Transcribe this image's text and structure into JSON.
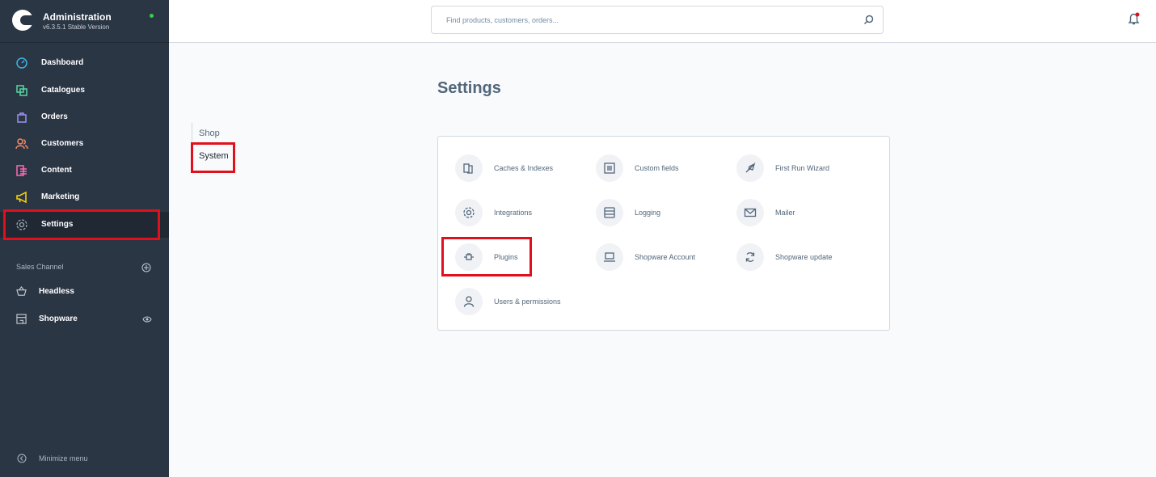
{
  "brand": {
    "title": "Administration",
    "version": "v6.3.5.1 Stable Version"
  },
  "nav": [
    {
      "label": "Dashboard",
      "icon": "dashboard-icon",
      "color": "#3db2e4"
    },
    {
      "label": "Catalogues",
      "icon": "catalogues-icon",
      "color": "#57d9a3"
    },
    {
      "label": "Orders",
      "icon": "orders-icon",
      "color": "#a092f0"
    },
    {
      "label": "Customers",
      "icon": "customers-icon",
      "color": "#f88962"
    },
    {
      "label": "Content",
      "icon": "content-icon",
      "color": "#ff68b4"
    },
    {
      "label": "Marketing",
      "icon": "marketing-icon",
      "color": "#ffd700"
    },
    {
      "label": "Settings",
      "icon": "settings-gear-icon",
      "color": "#9aa8b5"
    }
  ],
  "sales_channel": {
    "title": "Sales Channel",
    "items": [
      {
        "label": "Headless",
        "icon": "basket-icon"
      },
      {
        "label": "Shopware",
        "icon": "storefront-icon"
      }
    ]
  },
  "minimize_label": "Minimize menu",
  "search": {
    "placeholder": "Find products, customers, orders..."
  },
  "page": {
    "title": "Settings"
  },
  "tabs": [
    "Shop",
    "System"
  ],
  "settings": [
    {
      "label": "Caches & Indexes",
      "icon": "caches-icon"
    },
    {
      "label": "Custom fields",
      "icon": "custom-fields-icon"
    },
    {
      "label": "First Run Wizard",
      "icon": "rocket-icon"
    },
    {
      "label": "Integrations",
      "icon": "integrations-gear-icon"
    },
    {
      "label": "Logging",
      "icon": "logging-icon"
    },
    {
      "label": "Mailer",
      "icon": "mail-icon"
    },
    {
      "label": "Plugins",
      "icon": "plugin-icon"
    },
    {
      "label": "Shopware Account",
      "icon": "laptop-icon"
    },
    {
      "label": "Shopware update",
      "icon": "refresh-icon"
    },
    {
      "label": "Users & permissions",
      "icon": "user-icon"
    }
  ],
  "colors": {
    "sidebar": "#2b3645",
    "highlight": "#e0101c",
    "status": "#37d046"
  }
}
